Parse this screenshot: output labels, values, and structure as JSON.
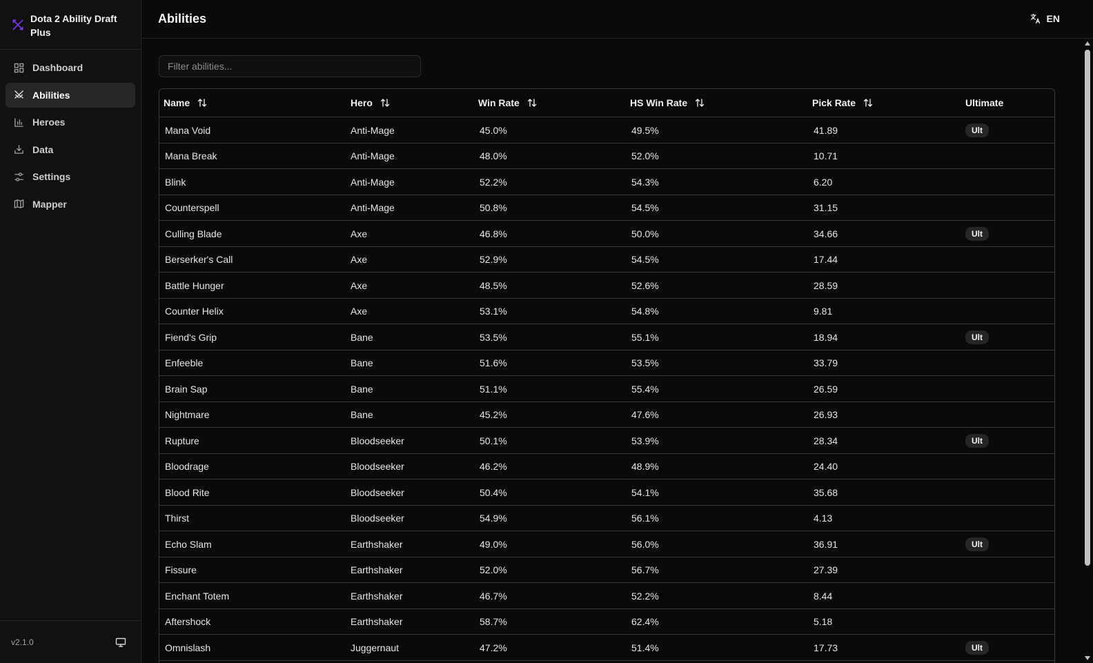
{
  "app": {
    "title": "Dota 2 Ability Draft Plus",
    "version": "v2.1.0"
  },
  "sidebar": {
    "items": [
      {
        "label": "Dashboard",
        "icon": "dashboard-icon",
        "active": false
      },
      {
        "label": "Abilities",
        "icon": "swords-icon",
        "active": true
      },
      {
        "label": "Heroes",
        "icon": "bar-chart-icon",
        "active": false
      },
      {
        "label": "Data",
        "icon": "download-icon",
        "active": false
      },
      {
        "label": "Settings",
        "icon": "sliders-icon",
        "active": false
      },
      {
        "label": "Mapper",
        "icon": "map-icon",
        "active": false
      }
    ]
  },
  "header": {
    "title": "Abilities",
    "language": "EN"
  },
  "filter": {
    "placeholder": "Filter abilities...",
    "value": ""
  },
  "table": {
    "columns": [
      "Name",
      "Hero",
      "Win Rate",
      "HS Win Rate",
      "Pick Rate",
      "Ultimate"
    ],
    "ult_label": "Ult",
    "rows": [
      {
        "name": "Mana Void",
        "hero": "Anti-Mage",
        "win": "45.0%",
        "hs": "49.5%",
        "pick": "41.89",
        "ult": true
      },
      {
        "name": "Mana Break",
        "hero": "Anti-Mage",
        "win": "48.0%",
        "hs": "52.0%",
        "pick": "10.71",
        "ult": false
      },
      {
        "name": "Blink",
        "hero": "Anti-Mage",
        "win": "52.2%",
        "hs": "54.3%",
        "pick": "6.20",
        "ult": false
      },
      {
        "name": "Counterspell",
        "hero": "Anti-Mage",
        "win": "50.8%",
        "hs": "54.5%",
        "pick": "31.15",
        "ult": false
      },
      {
        "name": "Culling Blade",
        "hero": "Axe",
        "win": "46.8%",
        "hs": "50.0%",
        "pick": "34.66",
        "ult": true
      },
      {
        "name": "Berserker's Call",
        "hero": "Axe",
        "win": "52.9%",
        "hs": "54.5%",
        "pick": "17.44",
        "ult": false
      },
      {
        "name": "Battle Hunger",
        "hero": "Axe",
        "win": "48.5%",
        "hs": "52.6%",
        "pick": "28.59",
        "ult": false
      },
      {
        "name": "Counter Helix",
        "hero": "Axe",
        "win": "53.1%",
        "hs": "54.8%",
        "pick": "9.81",
        "ult": false
      },
      {
        "name": "Fiend's Grip",
        "hero": "Bane",
        "win": "53.5%",
        "hs": "55.1%",
        "pick": "18.94",
        "ult": true
      },
      {
        "name": "Enfeeble",
        "hero": "Bane",
        "win": "51.6%",
        "hs": "53.5%",
        "pick": "33.79",
        "ult": false
      },
      {
        "name": "Brain Sap",
        "hero": "Bane",
        "win": "51.1%",
        "hs": "55.4%",
        "pick": "26.59",
        "ult": false
      },
      {
        "name": "Nightmare",
        "hero": "Bane",
        "win": "45.2%",
        "hs": "47.6%",
        "pick": "26.93",
        "ult": false
      },
      {
        "name": "Rupture",
        "hero": "Bloodseeker",
        "win": "50.1%",
        "hs": "53.9%",
        "pick": "28.34",
        "ult": true
      },
      {
        "name": "Bloodrage",
        "hero": "Bloodseeker",
        "win": "46.2%",
        "hs": "48.9%",
        "pick": "24.40",
        "ult": false
      },
      {
        "name": "Blood Rite",
        "hero": "Bloodseeker",
        "win": "50.4%",
        "hs": "54.1%",
        "pick": "35.68",
        "ult": false
      },
      {
        "name": "Thirst",
        "hero": "Bloodseeker",
        "win": "54.9%",
        "hs": "56.1%",
        "pick": "4.13",
        "ult": false
      },
      {
        "name": "Echo Slam",
        "hero": "Earthshaker",
        "win": "49.0%",
        "hs": "56.0%",
        "pick": "36.91",
        "ult": true
      },
      {
        "name": "Fissure",
        "hero": "Earthshaker",
        "win": "52.0%",
        "hs": "56.7%",
        "pick": "27.39",
        "ult": false
      },
      {
        "name": "Enchant Totem",
        "hero": "Earthshaker",
        "win": "46.7%",
        "hs": "52.2%",
        "pick": "8.44",
        "ult": false
      },
      {
        "name": "Aftershock",
        "hero": "Earthshaker",
        "win": "58.7%",
        "hs": "62.4%",
        "pick": "5.18",
        "ult": false
      },
      {
        "name": "Omnislash",
        "hero": "Juggernaut",
        "win": "47.2%",
        "hs": "51.4%",
        "pick": "17.73",
        "ult": true
      }
    ]
  },
  "colors": {
    "accent": "#7c3aed",
    "background": "#0a0a0a",
    "sidebar": "#111111",
    "active_item": "#262626"
  }
}
